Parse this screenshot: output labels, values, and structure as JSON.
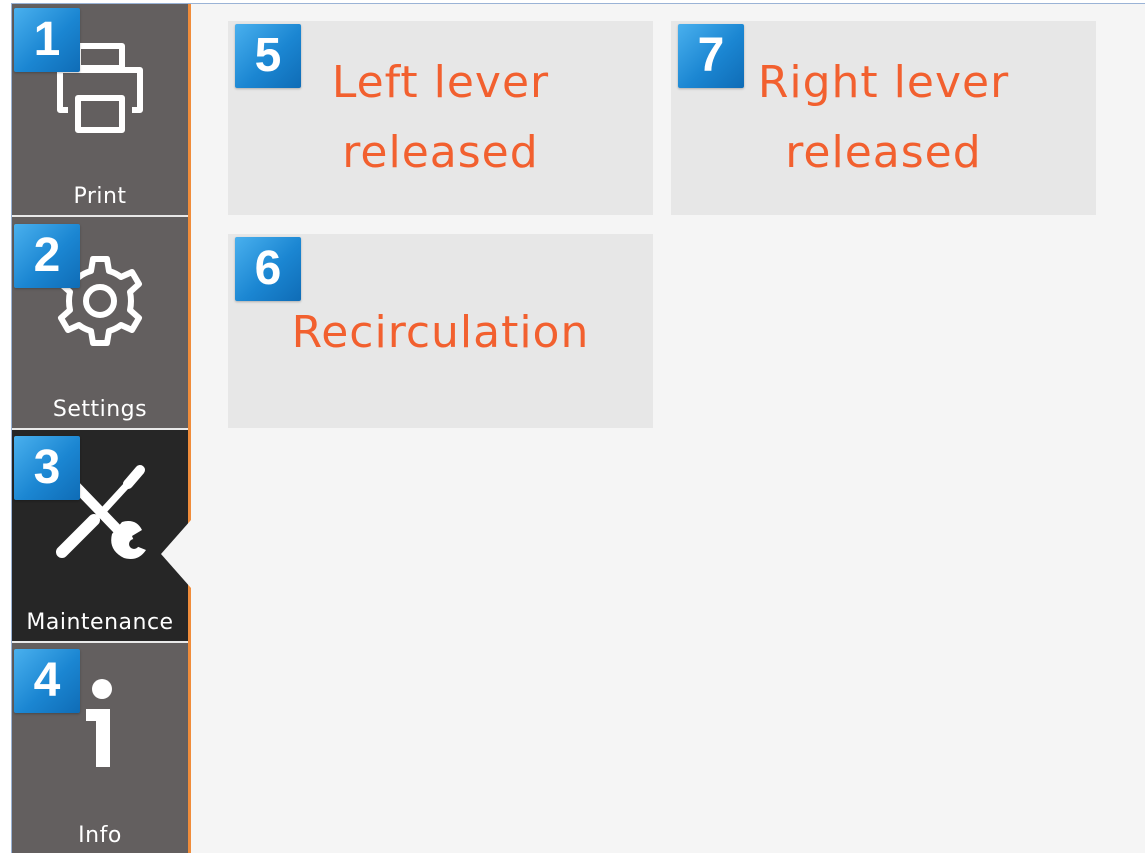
{
  "sidebar": {
    "items": [
      {
        "key": "print",
        "label": "Print",
        "icon": "printer-icon",
        "badge": "1",
        "active": false
      },
      {
        "key": "settings",
        "label": "Settings",
        "icon": "gear-icon",
        "badge": "2",
        "active": false
      },
      {
        "key": "maintenance",
        "label": "Maintenance",
        "icon": "wrench-screwdriver-icon",
        "badge": "3",
        "active": true
      },
      {
        "key": "info",
        "label": "Info",
        "icon": "info-icon",
        "badge": "4",
        "active": false
      }
    ]
  },
  "main": {
    "tiles": [
      {
        "key": "left-lever",
        "label": "Left lever\nreleased",
        "badge": "5"
      },
      {
        "key": "recirculation",
        "label": "Recirculation",
        "badge": "6"
      },
      {
        "key": "right-lever",
        "label": "Right lever\nreleased",
        "badge": "7"
      }
    ]
  },
  "colors": {
    "accent": "#f2602f",
    "sidebar_bg": "#635f5f",
    "sidebar_active_bg": "#262626",
    "sidebar_border": "#f08c3a",
    "badge": "#1b86d2",
    "tile_bg": "#e7e7e7",
    "content_bg": "#f5f5f5"
  }
}
